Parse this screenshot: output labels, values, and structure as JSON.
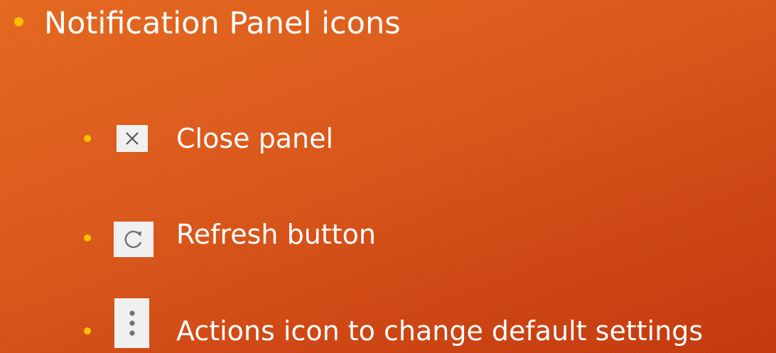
{
  "slide": {
    "title": "Notification Panel icons",
    "items": [
      {
        "icon": "close-icon",
        "label": "Close panel"
      },
      {
        "icon": "refresh-icon",
        "label": "Refresh button"
      },
      {
        "icon": "kebab-menu-icon",
        "label": "Actions icon to change default settings"
      }
    ]
  },
  "colors": {
    "background": "#d8521a",
    "bullet": "#ffc000",
    "text": "#ffffff",
    "icon_tile": "#f0f0f0"
  }
}
